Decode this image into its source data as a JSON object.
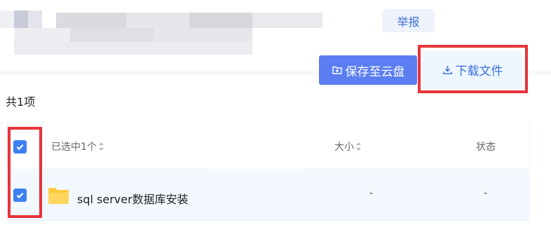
{
  "header": {
    "report_label": "举报"
  },
  "toolbar": {
    "save_label": "保存至云盘",
    "download_label": "下载文件"
  },
  "summary": {
    "total_label": "共1项"
  },
  "table": {
    "columns": [
      {
        "label": "已选中1个"
      },
      {
        "label": "大小"
      },
      {
        "label": "状态"
      }
    ],
    "rows": [
      {
        "name": "sql server数据库安装",
        "size": "-",
        "status": "-",
        "checked": true,
        "icon": "folder-icon"
      }
    ],
    "header_checked": true
  },
  "colors": {
    "accent": "#5b7ef2",
    "link": "#3b6fd6",
    "checkbox": "#3d7ff3",
    "highlight": "#e8333b",
    "folder": "#ffc93c"
  }
}
